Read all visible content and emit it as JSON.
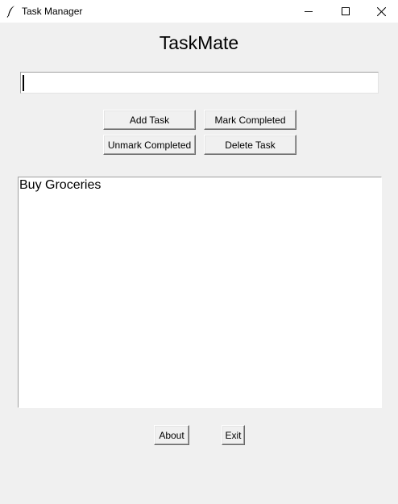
{
  "window": {
    "title": "Task Manager"
  },
  "app": {
    "heading": "TaskMate"
  },
  "entry": {
    "value": ""
  },
  "buttons": {
    "add_task": "Add Task",
    "mark_completed": "Mark Completed",
    "unmark_completed": "Unmark Completed",
    "delete_task": "Delete Task",
    "about": "About",
    "exit": "Exit"
  },
  "tasks": [
    "Buy Groceries"
  ]
}
